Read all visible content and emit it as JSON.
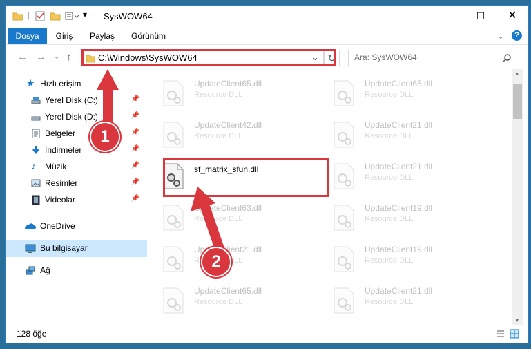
{
  "window": {
    "title": "SysWOW64"
  },
  "tabs": [
    {
      "label": "Dosya",
      "active": true
    },
    {
      "label": "Giriş"
    },
    {
      "label": "Paylaş"
    },
    {
      "label": "Görünüm"
    }
  ],
  "address": {
    "path": "C:\\Windows\\SysWOW64"
  },
  "search": {
    "placeholder": "Ara: SysWOW64"
  },
  "sidebar": {
    "quick_access": "Hızlı erişim",
    "items": [
      {
        "label": "Yerel Disk (C:)",
        "icon": "drive-icon"
      },
      {
        "label": "Yerel Disk (D:)",
        "icon": "drive-icon"
      },
      {
        "label": "Belgeler",
        "icon": "documents-icon"
      },
      {
        "label": "İndirmeler",
        "icon": "download-icon"
      },
      {
        "label": "Müzik",
        "icon": "music-icon"
      },
      {
        "label": "Resimler",
        "icon": "pictures-icon"
      },
      {
        "label": "Videolar",
        "icon": "videos-icon"
      }
    ],
    "onedrive": "OneDrive",
    "this_pc": "Bu bilgisayar",
    "network": "Ağ"
  },
  "files": [
    {
      "name": "UpdateClient65.dll",
      "type": "Resource DLL"
    },
    {
      "name": "UpdateClient65.dll",
      "type": "Resource DLL"
    },
    {
      "name": "UpdateClient42.dll",
      "type": "Resource DLL"
    },
    {
      "name": "UpdateClient21.dll",
      "type": "Resource DLL"
    },
    {
      "name": "sf_matrix_sfun.dll",
      "type": ""
    },
    {
      "name": "UpdateClient21.dll",
      "type": "Resource DLL"
    },
    {
      "name": "UpdateClient63.dll",
      "type": "Resource DLL"
    },
    {
      "name": "UpdateClient19.dll",
      "type": "Resource DLL"
    },
    {
      "name": "UpdateClient21.dll",
      "type": "Resource DLL"
    },
    {
      "name": "UpdateClient19.dll",
      "type": "Resource DLL"
    },
    {
      "name": "UpdateClient65.dll",
      "type": "Resource DLL"
    },
    {
      "name": "UpdateClient21.dll",
      "type": "Resource DLL"
    }
  ],
  "status": {
    "count": "128 öğe"
  },
  "annotations": {
    "step1": "1",
    "step2": "2"
  },
  "colors": {
    "accent": "#1979ca",
    "highlight": "#d9363e",
    "selection": "#cce8ff"
  }
}
